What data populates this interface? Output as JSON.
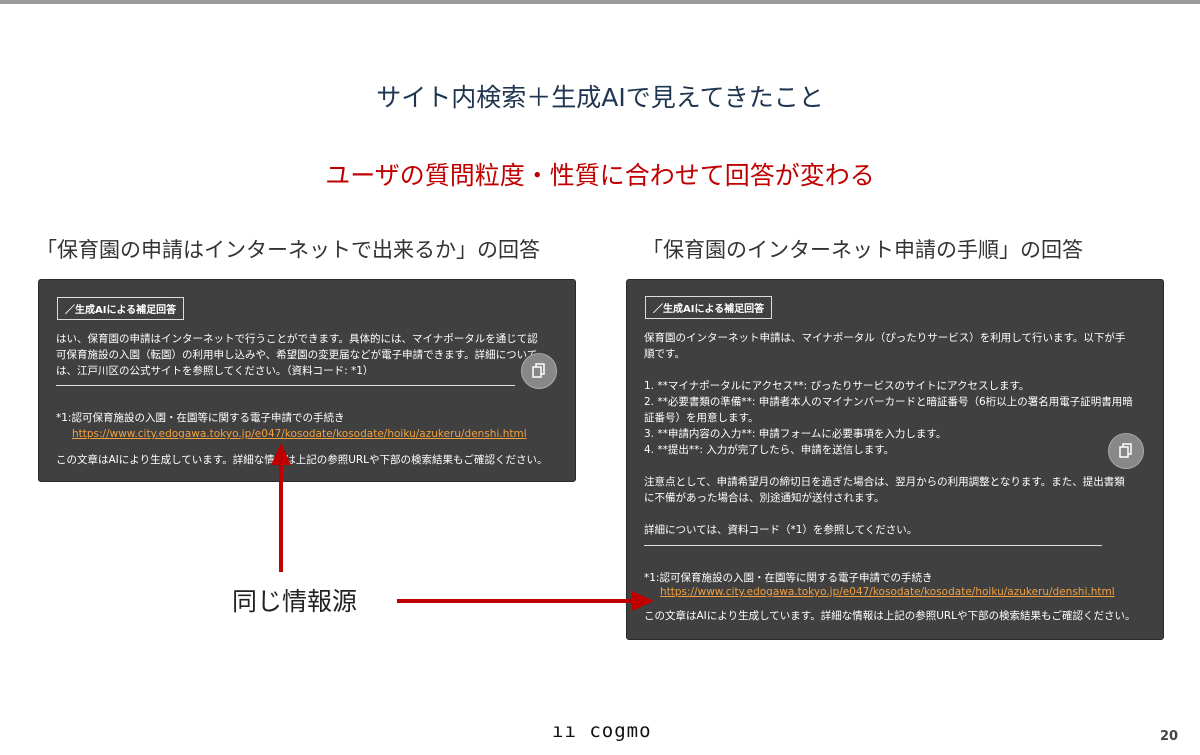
{
  "title": "サイト内検索＋生成AIで見えてきたこと",
  "subtitle": "ユーザの質問粒度・性質に合わせて回答が変わる",
  "left": {
    "label": "「保育園の申請はインターネットで出来るか」の回答",
    "badge": "／生成AIによる補足回答",
    "body": "はい、保育園の申請はインターネットで行うことができます。具体的には、マイナポータルを通じて認\n可保育施設の入園（転園）の利用申し込みや、希望園の変更届などが電子申請できます。詳細について\nは、江戸川区の公式サイトを参照してください。（資料コード: *1）",
    "footnote": "*1:認可保育施設の入園・在園等に関する電子申請での手続き",
    "url": "https://www.city.edogawa.tokyo.jp/e047/kosodate/kosodate/hoiku/azukeru/denshi.html",
    "disclaimer": "この文章はAIにより生成しています。詳細な情報は上記の参照URLや下部の検索結果もご確認ください。"
  },
  "right": {
    "label": "「保育園のインターネット申請の手順」の回答",
    "badge": "／生成AIによる補足回答",
    "body": "保育園のインターネット申請は、マイナポータル（ぴったりサービス）を利用して行います。以下が手\n順です。\n\n1. **マイナポータルにアクセス**: ぴったりサービスのサイトにアクセスします。\n2. **必要書類の準備**: 申請者本人のマイナンバーカードと暗証番号（6桁以上の署名用電子証明書用暗\n証番号）を用意します。\n3. **申請内容の入力**: 申請フォームに必要事項を入力します。\n4. **提出**: 入力が完了したら、申請を送信します。\n\n注意点として、申請希望月の締切日を過ぎた場合は、翌月からの利用調整となります。また、提出書類\nに不備があった場合は、別途通知が送付されます。\n\n詳細については、資料コード（*1）を参照してください。",
    "footnote": "*1:認可保育施設の入園・在園等に関する電子申請での手続き",
    "url": "https://www.city.edogawa.tokyo.jp/e047/kosodate/kosodate/hoiku/azukeru/denshi.html",
    "disclaimer": "この文章はAIにより生成しています。詳細な情報は上記の参照URLや下部の検索結果もご確認ください。"
  },
  "annotation": "同じ情報源",
  "footer": {
    "logo": "cogmo",
    "page": "20"
  },
  "colors": {
    "accent": "#c00000",
    "panel": "#404040",
    "link": "#f0a040"
  }
}
